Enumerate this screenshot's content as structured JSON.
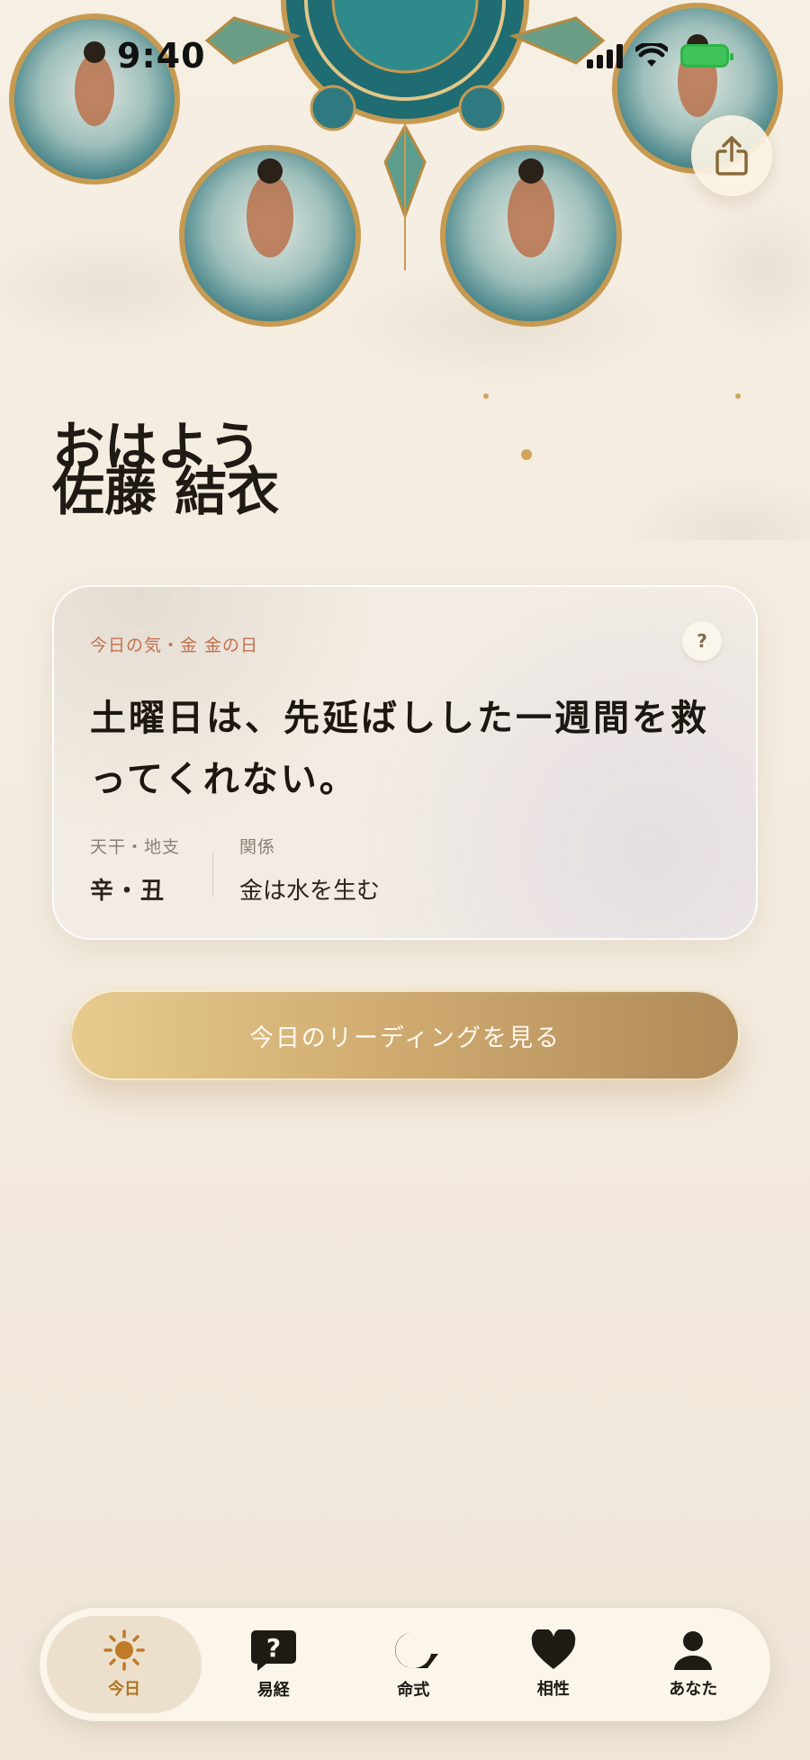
{
  "status_bar": {
    "time": "9:40"
  },
  "greeting": {
    "line1": "おはよう",
    "line2": "佐藤 結衣"
  },
  "card": {
    "tag": "今日の気・金  金の日",
    "help": "?",
    "message": "土曜日は、先延ばしした一週間を救ってくれない。",
    "meta": [
      {
        "label": "天干・地支",
        "value": "辛・丑"
      },
      {
        "label": "関係",
        "value": "金は水を生む"
      }
    ]
  },
  "cta": {
    "label": "今日のリーディングを見る"
  },
  "tabs": [
    {
      "label": "今日",
      "icon": "sun-icon",
      "active": true
    },
    {
      "label": "易経",
      "icon": "question-bubble-icon",
      "active": false
    },
    {
      "label": "命式",
      "icon": "nautilus-icon",
      "active": false
    },
    {
      "label": "相性",
      "icon": "heart-icon",
      "active": false
    },
    {
      "label": "あなた",
      "icon": "person-icon",
      "active": false
    }
  ],
  "colors": {
    "accent_gold": "#d1ad72",
    "active_tab": "#b0741f",
    "tag_text": "#c2704f",
    "battery": "#3fc35a"
  }
}
